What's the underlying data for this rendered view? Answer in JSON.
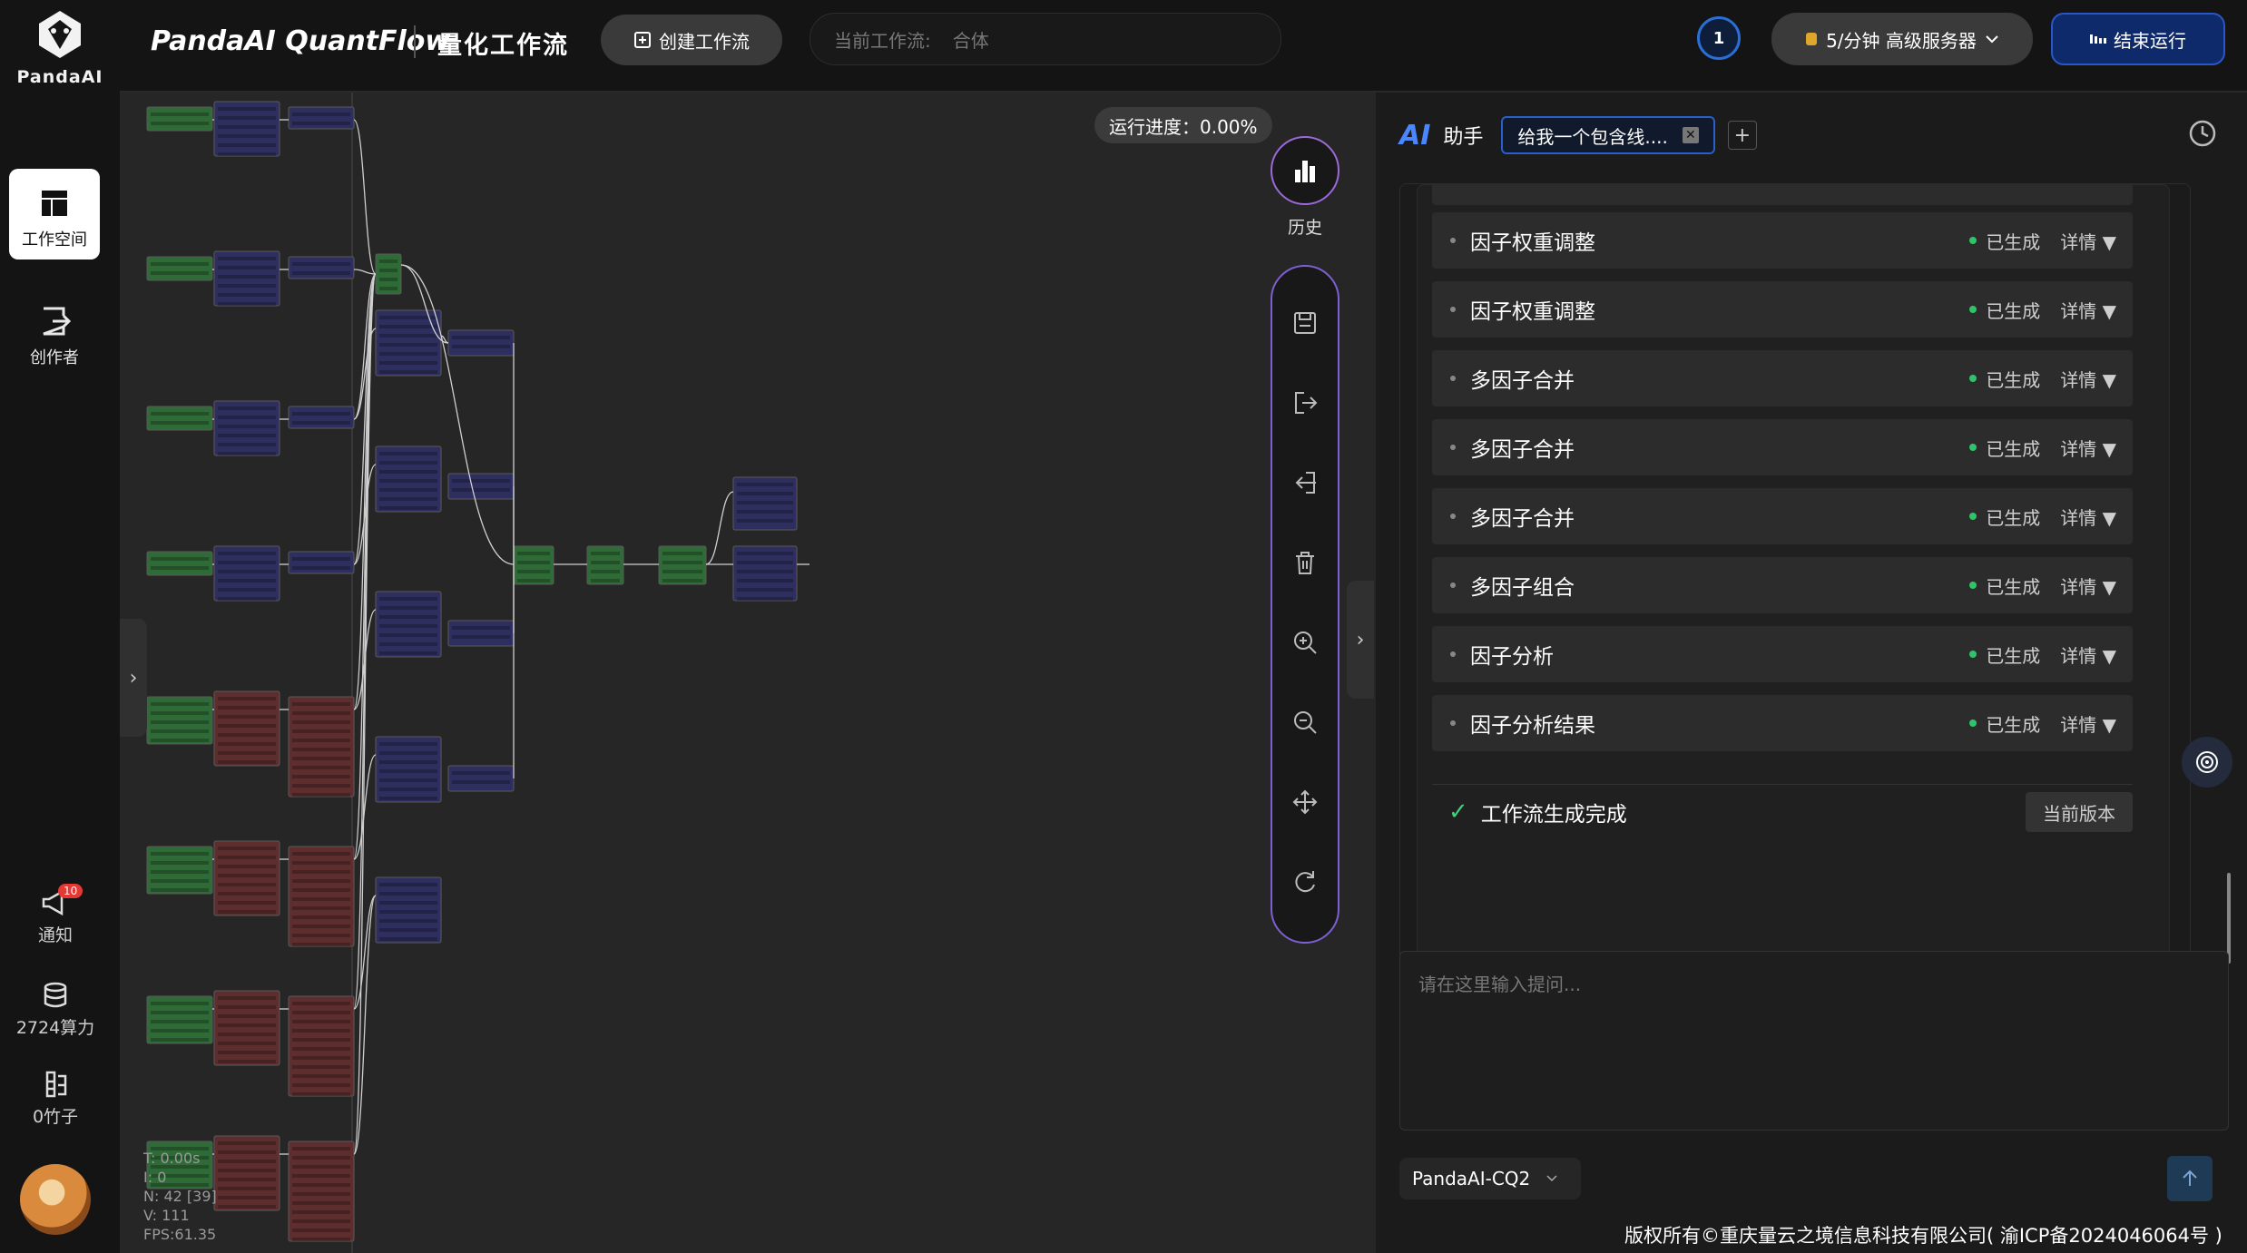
{
  "sidebar": {
    "logo_text": "PandaAI",
    "items": [
      {
        "label": "工作空间",
        "icon": "workspace-icon",
        "active": true
      },
      {
        "label": "创作者",
        "icon": "creator-icon",
        "active": false
      }
    ],
    "notify": {
      "label": "通知",
      "badge": "10"
    },
    "compute": {
      "label": "2724算力"
    },
    "bamboo": {
      "label": "0竹子"
    }
  },
  "header": {
    "brand": "PandaAI QuantFlow",
    "subtitle": "量化工作流",
    "create_label": "创建工作流",
    "current_flow_label": "当前工作流:",
    "current_flow_value": "合体",
    "status_count": "1",
    "server_label": "5/分钟  高级服务器",
    "end_label": "结束运行"
  },
  "canvas": {
    "progress": "运行进度：0.00%",
    "history_label": "历史",
    "debug": {
      "t": "T: 0.00s",
      "i": "I: 0",
      "n": "N: 42 [39]",
      "v": "V: 111",
      "fps": "FPS:61.35"
    },
    "tools": [
      "save-icon",
      "export-icon",
      "import-icon",
      "delete-icon",
      "zoom-in-icon",
      "zoom-out-icon",
      "move-icon",
      "refresh-icon"
    ]
  },
  "assistant": {
    "logo": "AI",
    "title": "助手",
    "tab_label": "给我一个包含线....",
    "items": [
      {
        "name": "因子权重调整",
        "status": "已生成",
        "detail": "详情 ▼"
      },
      {
        "name": "因子权重调整",
        "status": "已生成",
        "detail": "详情 ▼"
      },
      {
        "name": "多因子合并",
        "status": "已生成",
        "detail": "详情 ▼"
      },
      {
        "name": "多因子合并",
        "status": "已生成",
        "detail": "详情 ▼"
      },
      {
        "name": "多因子合并",
        "status": "已生成",
        "detail": "详情 ▼"
      },
      {
        "name": "多因子组合",
        "status": "已生成",
        "detail": "详情 ▼"
      },
      {
        "name": "因子分析",
        "status": "已生成",
        "detail": "详情 ▼"
      },
      {
        "name": "因子分析结果",
        "status": "已生成",
        "detail": "详情 ▼"
      }
    ],
    "done_label": "工作流生成完成",
    "version_label": "当前版本",
    "prompt_placeholder": "请在这里输入提问...",
    "model": "PandaAI-CQ2"
  },
  "footer": "版权所有©重庆量云之境信息科技有限公司( 渝ICP备2024046064号 )",
  "colors": {
    "accent": "#2a56c8",
    "node_green": "#2f6b36",
    "node_blue": "#2e2f5e",
    "node_red": "#5e2e2e",
    "ok": "#31c36a"
  }
}
